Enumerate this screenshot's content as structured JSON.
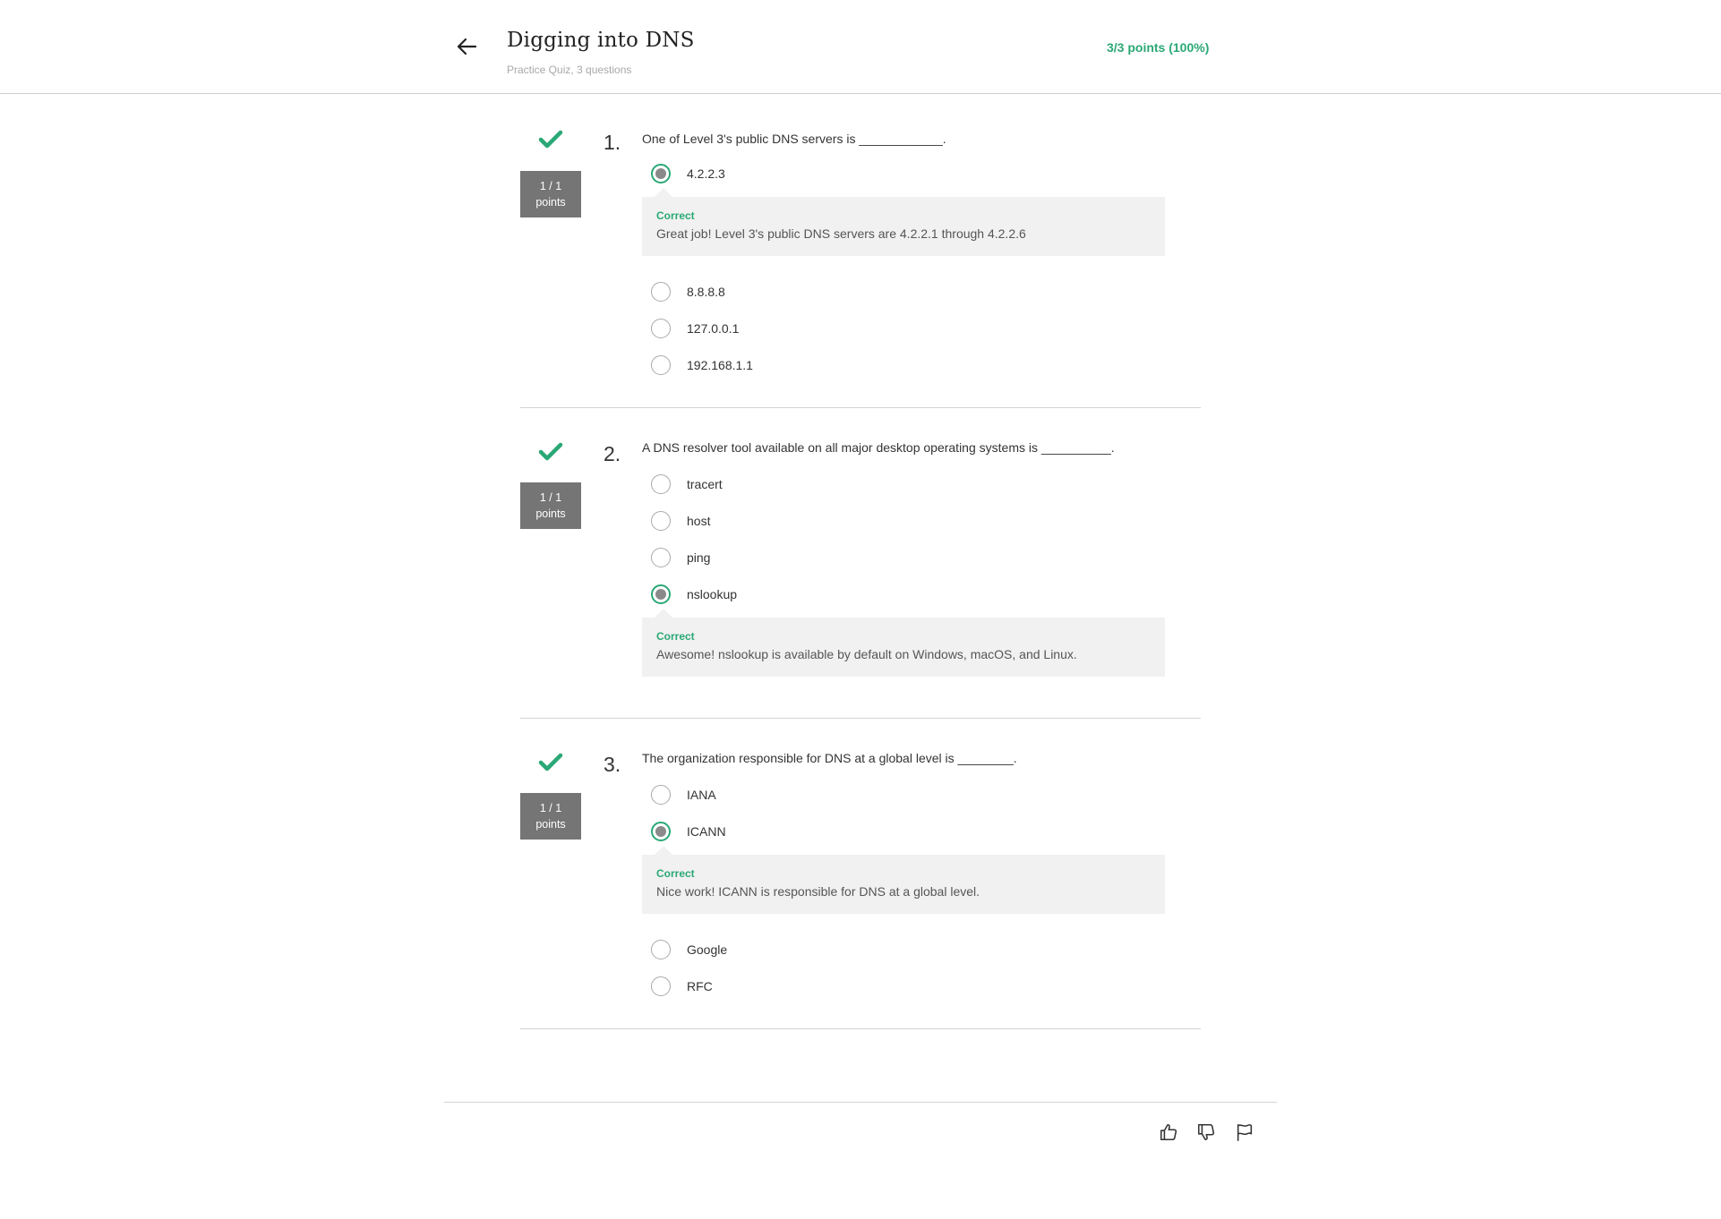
{
  "header": {
    "title": "Digging into DNS",
    "subtitle": "Practice Quiz, 3 questions",
    "score": "3/3 points (100%)",
    "back_icon": "arrow-left-icon"
  },
  "colors": {
    "accent_green": "#2aa876",
    "badge_gray": "#757575",
    "feedback_bg": "#f1f1f1"
  },
  "questions": [
    {
      "number": "1.",
      "text": "One of Level 3's public DNS servers is ____________.",
      "badge_score": "1 / 1",
      "badge_label": "points",
      "status_icon": "checkmark-icon",
      "options": [
        {
          "label": "4.2.2.3",
          "selected": true
        },
        {
          "label": "8.8.8.8",
          "selected": false
        },
        {
          "label": "127.0.0.1",
          "selected": false
        },
        {
          "label": "192.168.1.1",
          "selected": false
        }
      ],
      "feedback": {
        "status": "Correct",
        "text": "Great job! Level 3's public DNS servers are 4.2.2.1 through 4.2.2.6"
      }
    },
    {
      "number": "2.",
      "text": "A DNS resolver tool available on all major desktop operating systems is __________.",
      "badge_score": "1 / 1",
      "badge_label": "points",
      "status_icon": "checkmark-icon",
      "options": [
        {
          "label": "tracert",
          "selected": false
        },
        {
          "label": "host",
          "selected": false
        },
        {
          "label": "ping",
          "selected": false
        },
        {
          "label": "nslookup",
          "selected": true
        }
      ],
      "feedback": {
        "status": "Correct",
        "text": "Awesome! nslookup is available by default on Windows, macOS, and Linux."
      }
    },
    {
      "number": "3.",
      "text": "The organization responsible for DNS at a global level is ________.",
      "badge_score": "1 / 1",
      "badge_label": "points",
      "status_icon": "checkmark-icon",
      "options": [
        {
          "label": "IANA",
          "selected": false
        },
        {
          "label": "ICANN",
          "selected": true
        },
        {
          "label": "Google",
          "selected": false
        },
        {
          "label": "RFC",
          "selected": false
        }
      ],
      "feedback": {
        "status": "Correct",
        "text": "Nice work! ICANN is responsible for DNS at a global level."
      }
    }
  ],
  "footer": {
    "icons": [
      "thumbs-up-icon",
      "thumbs-down-icon",
      "flag-icon"
    ]
  }
}
